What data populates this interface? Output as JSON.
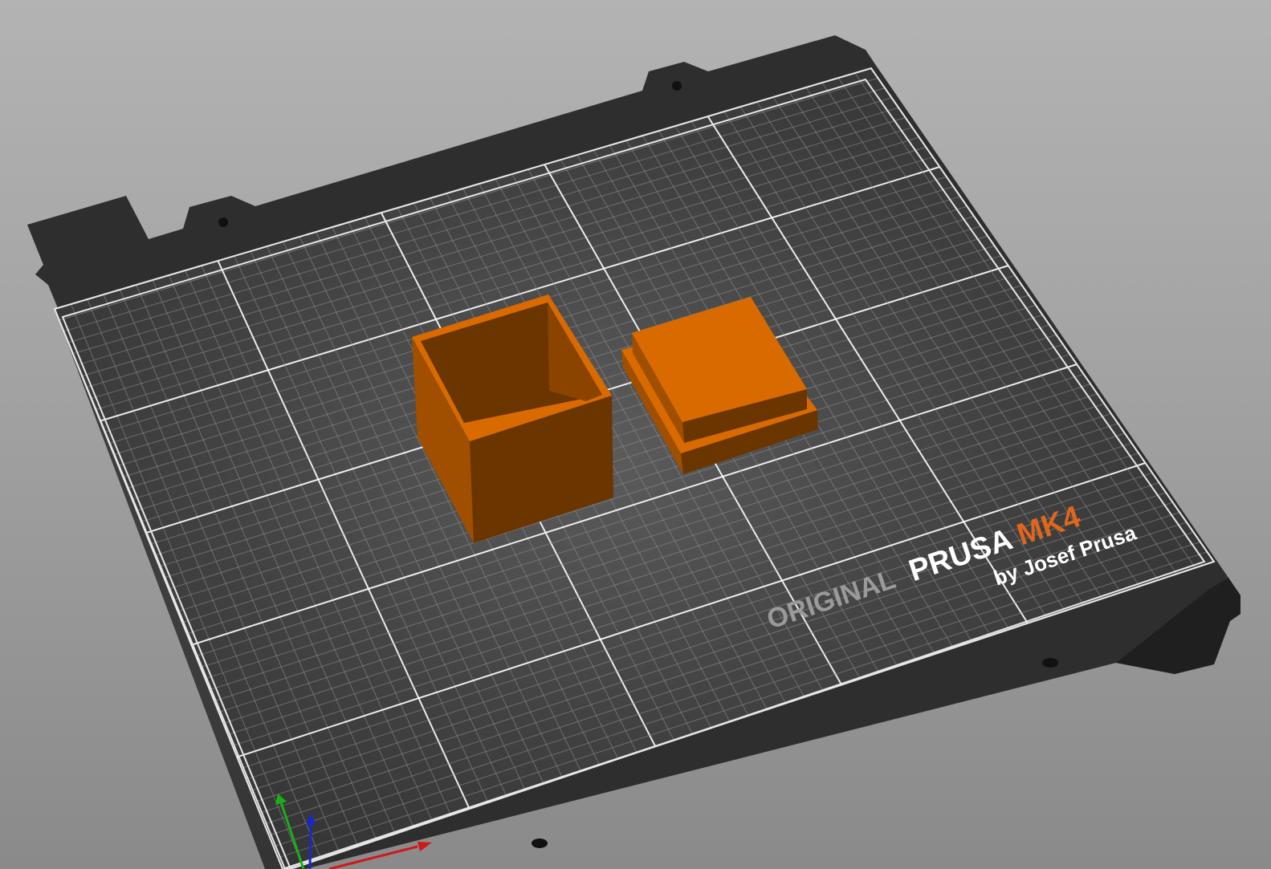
{
  "scene": {
    "printer_bed": {
      "logo": {
        "word_original": "ORIGINAL",
        "word_prusa": "PRUSA",
        "word_model": "MK4",
        "byline": "by Josef Prusa"
      },
      "colors": {
        "plate": "#3a3a3a",
        "plate_dark": "#262626",
        "grid_major": "#ffffff",
        "grid_minor": "#8c8c8c",
        "logo_original": "#9a9a9a",
        "logo_prusa": "#ffffff",
        "logo_model": "#e0661c"
      }
    },
    "objects": [
      {
        "name": "box",
        "color": "#d96a00",
        "shade_side": "#a04e00",
        "shade_dark": "#6b3500"
      },
      {
        "name": "lid",
        "color": "#d96a00",
        "shade_side": "#a04e00",
        "shade_dark": "#6b3500"
      }
    ],
    "axes": {
      "x_color": "#d01818",
      "y_color": "#18b018",
      "z_color": "#1828c8"
    }
  }
}
